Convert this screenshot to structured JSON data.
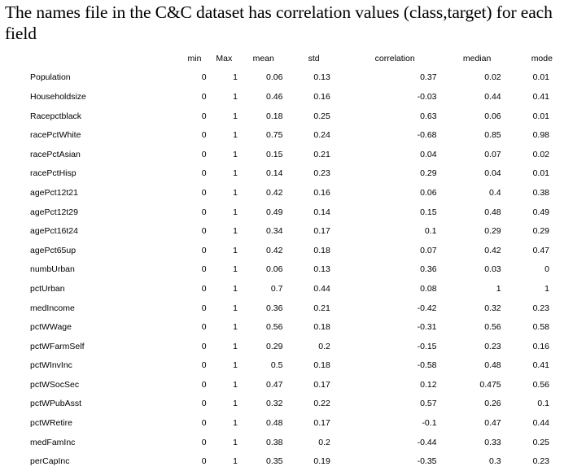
{
  "slide": {
    "title": "The names file in the C&C dataset has correlation values (class,target) for each field"
  },
  "table": {
    "headers": {
      "field": "",
      "min": "min",
      "max": "Max",
      "mean": "mean",
      "std": "std",
      "correlation": "correlation",
      "median": "median",
      "mode": "mode"
    },
    "rows": [
      {
        "field": "Population",
        "min": "0",
        "max": "1",
        "mean": "0.06",
        "std": "0.13",
        "correlation": "0.37",
        "median": "0.02",
        "mode": "0.01"
      },
      {
        "field": "Householdsize",
        "min": "0",
        "max": "1",
        "mean": "0.46",
        "std": "0.16",
        "correlation": "-0.03",
        "median": "0.44",
        "mode": "0.41"
      },
      {
        "field": "Racepctblack",
        "min": "0",
        "max": "1",
        "mean": "0.18",
        "std": "0.25",
        "correlation": "0.63",
        "median": "0.06",
        "mode": "0.01"
      },
      {
        "field": "racePctWhite",
        "min": "0",
        "max": "1",
        "mean": "0.75",
        "std": "0.24",
        "correlation": "-0.68",
        "median": "0.85",
        "mode": "0.98"
      },
      {
        "field": "racePctAsian",
        "min": "0",
        "max": "1",
        "mean": "0.15",
        "std": "0.21",
        "correlation": "0.04",
        "median": "0.07",
        "mode": "0.02"
      },
      {
        "field": "racePctHisp",
        "min": "0",
        "max": "1",
        "mean": "0.14",
        "std": "0.23",
        "correlation": "0.29",
        "median": "0.04",
        "mode": "0.01"
      },
      {
        "field": "agePct12t21",
        "min": "0",
        "max": "1",
        "mean": "0.42",
        "std": "0.16",
        "correlation": "0.06",
        "median": "0.4",
        "mode": "0.38"
      },
      {
        "field": "agePct12t29",
        "min": "0",
        "max": "1",
        "mean": "0.49",
        "std": "0.14",
        "correlation": "0.15",
        "median": "0.48",
        "mode": "0.49"
      },
      {
        "field": "agePct16t24",
        "min": "0",
        "max": "1",
        "mean": "0.34",
        "std": "0.17",
        "correlation": "0.1",
        "median": "0.29",
        "mode": "0.29"
      },
      {
        "field": "agePct65up",
        "min": "0",
        "max": "1",
        "mean": "0.42",
        "std": "0.18",
        "correlation": "0.07",
        "median": "0.42",
        "mode": "0.47"
      },
      {
        "field": "numbUrban",
        "min": "0",
        "max": "1",
        "mean": "0.06",
        "std": "0.13",
        "correlation": "0.36",
        "median": "0.03",
        "mode": "0"
      },
      {
        "field": "pctUrban",
        "min": "0",
        "max": "1",
        "mean": "0.7",
        "std": "0.44",
        "correlation": "0.08",
        "median": "1",
        "mode": "1"
      },
      {
        "field": "medIncome",
        "min": "0",
        "max": "1",
        "mean": "0.36",
        "std": "0.21",
        "correlation": "-0.42",
        "median": "0.32",
        "mode": "0.23"
      },
      {
        "field": "pctWWage",
        "min": "0",
        "max": "1",
        "mean": "0.56",
        "std": "0.18",
        "correlation": "-0.31",
        "median": "0.56",
        "mode": "0.58"
      },
      {
        "field": "pctWFarmSelf",
        "min": "0",
        "max": "1",
        "mean": "0.29",
        "std": "0.2",
        "correlation": "-0.15",
        "median": "0.23",
        "mode": "0.16"
      },
      {
        "field": "pctWInvInc",
        "min": "0",
        "max": "1",
        "mean": "0.5",
        "std": "0.18",
        "correlation": "-0.58",
        "median": "0.48",
        "mode": "0.41"
      },
      {
        "field": "pctWSocSec",
        "min": "0",
        "max": "1",
        "mean": "0.47",
        "std": "0.17",
        "correlation": "0.12",
        "median": "0.475",
        "mode": "0.56"
      },
      {
        "field": "pctWPubAsst",
        "min": "0",
        "max": "1",
        "mean": "0.32",
        "std": "0.22",
        "correlation": "0.57",
        "median": "0.26",
        "mode": "0.1"
      },
      {
        "field": "pctWRetire",
        "min": "0",
        "max": "1",
        "mean": "0.48",
        "std": "0.17",
        "correlation": "-0.1",
        "median": "0.47",
        "mode": "0.44"
      },
      {
        "field": "medFamInc",
        "min": "0",
        "max": "1",
        "mean": "0.38",
        "std": "0.2",
        "correlation": "-0.44",
        "median": "0.33",
        "mode": "0.25"
      },
      {
        "field": "perCapInc",
        "min": "0",
        "max": "1",
        "mean": "0.35",
        "std": "0.19",
        "correlation": "-0.35",
        "median": "0.3",
        "mode": "0.23"
      }
    ]
  }
}
